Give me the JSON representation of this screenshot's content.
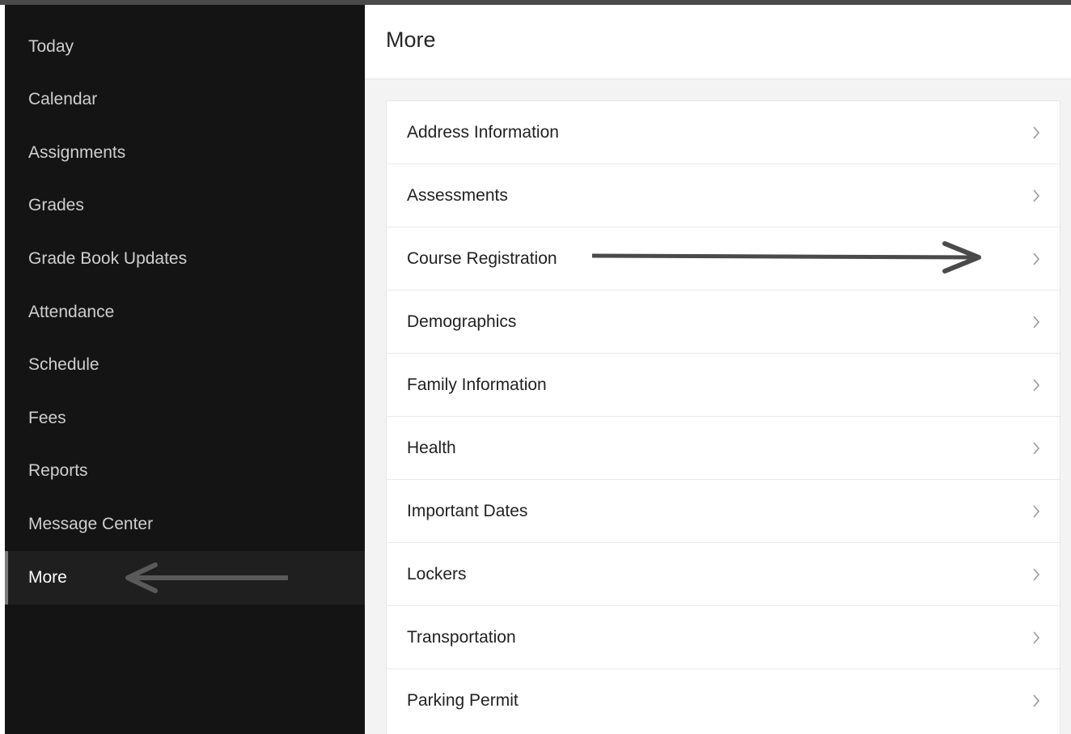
{
  "sidebar": {
    "items": [
      {
        "label": "Today"
      },
      {
        "label": "Calendar"
      },
      {
        "label": "Assignments"
      },
      {
        "label": "Grades"
      },
      {
        "label": "Grade Book Updates"
      },
      {
        "label": "Attendance"
      },
      {
        "label": "Schedule"
      },
      {
        "label": "Fees"
      },
      {
        "label": "Reports"
      },
      {
        "label": "Message Center"
      },
      {
        "label": "More"
      }
    ],
    "active_label": "More"
  },
  "main": {
    "title": "More",
    "rows": [
      {
        "label": "Address Information",
        "icon": "chevron-right-icon"
      },
      {
        "label": "Assessments",
        "icon": "chevron-right-icon"
      },
      {
        "label": "Course Registration",
        "icon": "chevron-right-icon"
      },
      {
        "label": "Demographics",
        "icon": "chevron-right-icon"
      },
      {
        "label": "Family Information",
        "icon": "chevron-right-icon"
      },
      {
        "label": "Health",
        "icon": "chevron-right-icon"
      },
      {
        "label": "Important Dates",
        "icon": "chevron-right-icon"
      },
      {
        "label": "Lockers",
        "icon": "chevron-right-icon"
      },
      {
        "label": "Transportation",
        "icon": "chevron-right-icon"
      },
      {
        "label": "Parking Permit",
        "icon": "chevron-right-icon"
      }
    ]
  },
  "colors": {
    "sidebar_bg": "#141414",
    "sidebar_active_bg": "#1f1f1f",
    "annotation_arrow": "#5a5a5a"
  }
}
